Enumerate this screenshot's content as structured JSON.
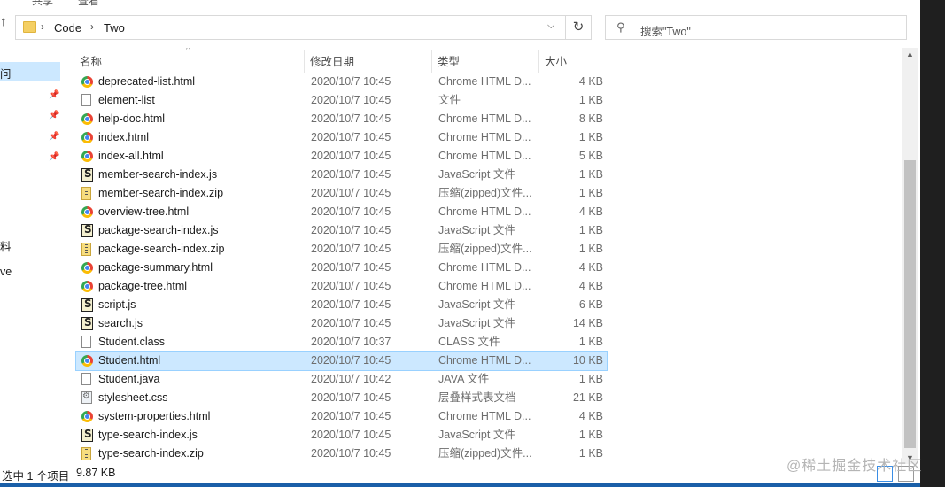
{
  "topstrip": {
    "ghost_left": "共享",
    "ghost_right": "查看"
  },
  "address": {
    "breadcrumbs": [
      "Code",
      "Two"
    ],
    "search_placeholder": "搜索\"Two\""
  },
  "nav": {
    "items": [
      "问",
      "料",
      "ve"
    ]
  },
  "columns": {
    "name": "名称",
    "date": "修改日期",
    "type": "类型",
    "size": "大小"
  },
  "files": [
    {
      "name": "deprecated-list.html",
      "date": "2020/10/7 10:45",
      "type": "Chrome HTML D...",
      "size": "4 KB",
      "icon": "chrome-icon"
    },
    {
      "name": "element-list",
      "date": "2020/10/7 10:45",
      "type": "文件",
      "size": "1 KB",
      "icon": "document-icon"
    },
    {
      "name": "help-doc.html",
      "date": "2020/10/7 10:45",
      "type": "Chrome HTML D...",
      "size": "8 KB",
      "icon": "chrome-icon"
    },
    {
      "name": "index.html",
      "date": "2020/10/7 10:45",
      "type": "Chrome HTML D...",
      "size": "1 KB",
      "icon": "chrome-icon"
    },
    {
      "name": "index-all.html",
      "date": "2020/10/7 10:45",
      "type": "Chrome HTML D...",
      "size": "5 KB",
      "icon": "chrome-icon"
    },
    {
      "name": "member-search-index.js",
      "date": "2020/10/7 10:45",
      "type": "JavaScript 文件",
      "size": "1 KB",
      "icon": "script-icon"
    },
    {
      "name": "member-search-index.zip",
      "date": "2020/10/7 10:45",
      "type": "压缩(zipped)文件...",
      "size": "1 KB",
      "icon": "zip-icon"
    },
    {
      "name": "overview-tree.html",
      "date": "2020/10/7 10:45",
      "type": "Chrome HTML D...",
      "size": "4 KB",
      "icon": "chrome-icon"
    },
    {
      "name": "package-search-index.js",
      "date": "2020/10/7 10:45",
      "type": "JavaScript 文件",
      "size": "1 KB",
      "icon": "script-icon"
    },
    {
      "name": "package-search-index.zip",
      "date": "2020/10/7 10:45",
      "type": "压缩(zipped)文件...",
      "size": "1 KB",
      "icon": "zip-icon"
    },
    {
      "name": "package-summary.html",
      "date": "2020/10/7 10:45",
      "type": "Chrome HTML D...",
      "size": "4 KB",
      "icon": "chrome-icon"
    },
    {
      "name": "package-tree.html",
      "date": "2020/10/7 10:45",
      "type": "Chrome HTML D...",
      "size": "4 KB",
      "icon": "chrome-icon"
    },
    {
      "name": "script.js",
      "date": "2020/10/7 10:45",
      "type": "JavaScript 文件",
      "size": "6 KB",
      "icon": "script-icon"
    },
    {
      "name": "search.js",
      "date": "2020/10/7 10:45",
      "type": "JavaScript 文件",
      "size": "14 KB",
      "icon": "script-icon"
    },
    {
      "name": "Student.class",
      "date": "2020/10/7 10:37",
      "type": "CLASS 文件",
      "size": "1 KB",
      "icon": "document-icon"
    },
    {
      "name": "Student.html",
      "date": "2020/10/7 10:45",
      "type": "Chrome HTML D...",
      "size": "10 KB",
      "icon": "chrome-icon",
      "selected": true
    },
    {
      "name": "Student.java",
      "date": "2020/10/7 10:42",
      "type": "JAVA 文件",
      "size": "1 KB",
      "icon": "document-icon"
    },
    {
      "name": "stylesheet.css",
      "date": "2020/10/7 10:45",
      "type": "层叠样式表文档",
      "size": "21 KB",
      "icon": "stylesheet-icon"
    },
    {
      "name": "system-properties.html",
      "date": "2020/10/7 10:45",
      "type": "Chrome HTML D...",
      "size": "4 KB",
      "icon": "chrome-icon"
    },
    {
      "name": "type-search-index.js",
      "date": "2020/10/7 10:45",
      "type": "JavaScript 文件",
      "size": "1 KB",
      "icon": "script-icon"
    },
    {
      "name": "type-search-index.zip",
      "date": "2020/10/7 10:45",
      "type": "压缩(zipped)文件...",
      "size": "1 KB",
      "icon": "zip-icon"
    }
  ],
  "status": {
    "selection": "选中 1 个项目",
    "size": "9.87 KB"
  },
  "watermark": "@稀土掘金技术社区"
}
